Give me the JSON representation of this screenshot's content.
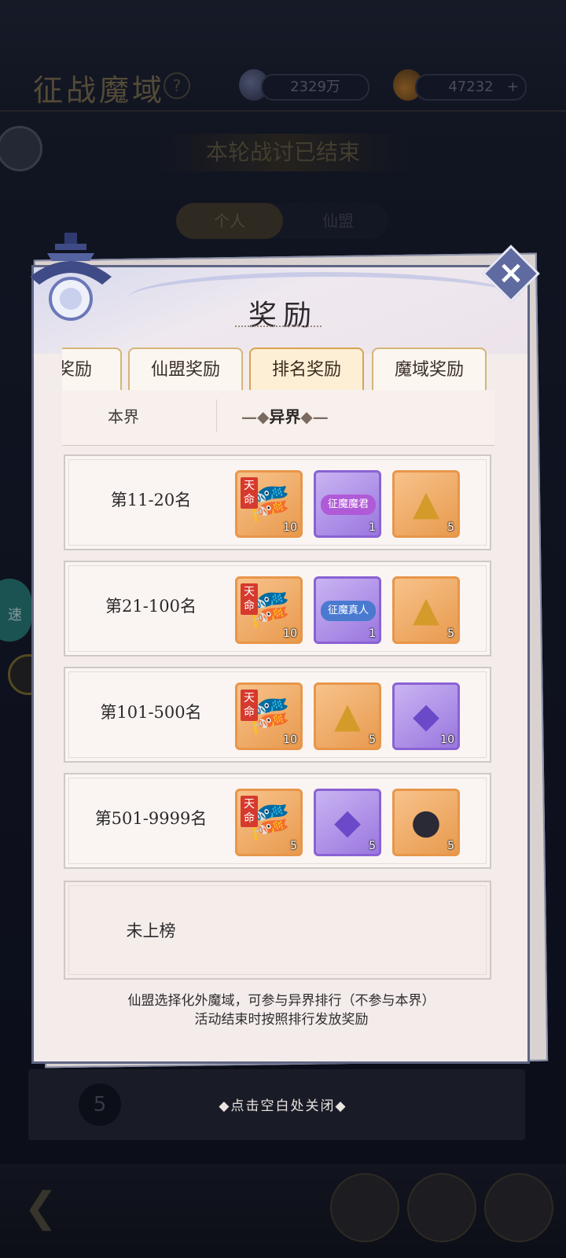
{
  "background": {
    "title": "征战魔域",
    "help": "?",
    "currency1": "2329万",
    "currency2": "47232",
    "add": "+",
    "banner": "本轮战讨已结束",
    "tab_personal": "个人",
    "tab_alliance": "仙盟",
    "rank_number": "5",
    "side_badge": "速"
  },
  "dialog": {
    "title": "奖励",
    "close": "×",
    "tabs": [
      {
        "label": "奖励",
        "active": false
      },
      {
        "label": "仙盟奖励",
        "active": false
      },
      {
        "label": "排名奖励",
        "active": true
      },
      {
        "label": "魔域奖励",
        "active": false
      }
    ],
    "subtabs": {
      "this_realm": "本界",
      "other_realm": "异界",
      "other_realm_deco": "—◆异界◆—"
    },
    "rows": [
      {
        "label": "第11-20名",
        "items": [
          {
            "icon": "tianming-fan-icon",
            "tag": "天命",
            "count": "10",
            "rarity": "orange"
          },
          {
            "icon": "title-badge-icon",
            "badge_text": "征魔魔君",
            "count": "1",
            "rarity": "purple"
          },
          {
            "icon": "gold-pyramid-icon",
            "count": "5",
            "rarity": "orange"
          }
        ]
      },
      {
        "label": "第21-100名",
        "items": [
          {
            "icon": "tianming-fan-icon",
            "tag": "天命",
            "count": "10",
            "rarity": "orange"
          },
          {
            "icon": "title-badge-icon",
            "badge_text": "征魔真人",
            "count": "1",
            "rarity": "purple"
          },
          {
            "icon": "gold-pyramid-icon",
            "count": "5",
            "rarity": "orange"
          }
        ]
      },
      {
        "label": "第101-500名",
        "items": [
          {
            "icon": "tianming-fan-icon",
            "tag": "天命",
            "count": "10",
            "rarity": "orange"
          },
          {
            "icon": "gold-pyramid-icon",
            "count": "5",
            "rarity": "orange"
          },
          {
            "icon": "purple-crystal-icon",
            "count": "10",
            "rarity": "purple"
          }
        ]
      },
      {
        "label": "第501-9999名",
        "items": [
          {
            "icon": "tianming-fan-icon",
            "tag": "天命",
            "count": "5",
            "rarity": "orange"
          },
          {
            "icon": "purple-crystal-icon",
            "count": "5",
            "rarity": "purple"
          },
          {
            "icon": "dark-orb-icon",
            "count": "5",
            "rarity": "orange"
          }
        ]
      }
    ],
    "unranked": "未上榜",
    "note_line1": "仙盟选择化外魔域，可参与异界排行（不参与本界）",
    "note_line2": "活动结束时按照排行发放奖励"
  },
  "close_hint": "◆点击空白处关闭◆"
}
